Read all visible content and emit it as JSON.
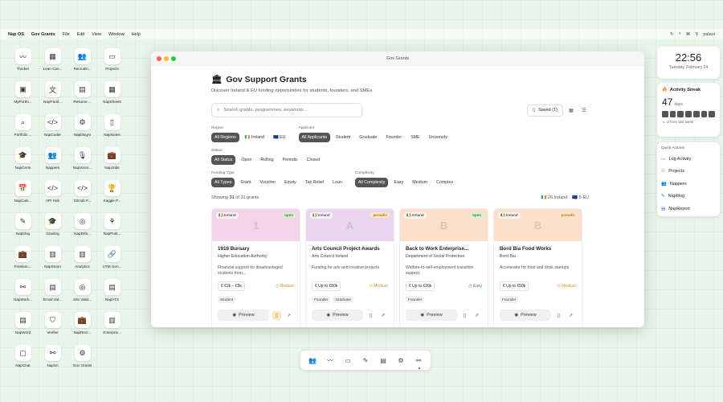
{
  "menubar": {
    "items": [
      "Nap OS",
      "Gov Grants",
      "File",
      "Edit",
      "View",
      "Window",
      "Help"
    ],
    "user": "palani"
  },
  "desktop": [
    {
      "label": "Tracker",
      "icon": "〰"
    },
    {
      "label": "Lean Can...",
      "icon": "▦"
    },
    {
      "label": "Recruitin...",
      "icon": "👥"
    },
    {
      "label": "Projects",
      "icon": "▭"
    },
    {
      "label": "MyPortfo...",
      "icon": "▣"
    },
    {
      "label": "NapParal...",
      "icon": "文"
    },
    {
      "label": "Resume ...",
      "icon": "▤"
    },
    {
      "label": "NapSheets",
      "icon": "▦"
    },
    {
      "label": "Portfolio ...",
      "icon": "⌕"
    },
    {
      "label": "NapCoder",
      "icon": "</>"
    },
    {
      "label": "NapblogAI",
      "icon": "⚙"
    },
    {
      "label": "NapNotes",
      "icon": "▯"
    },
    {
      "label": "NapCerts",
      "icon": "🎓"
    },
    {
      "label": "Nappers",
      "icon": "👥"
    },
    {
      "label": "NapVoice...",
      "icon": "🎙"
    },
    {
      "label": "NapJobs",
      "icon": "💼"
    },
    {
      "label": "NapCale...",
      "icon": "📅"
    },
    {
      "label": "API Hub",
      "icon": "</>"
    },
    {
      "label": "GitHub P...",
      "icon": "</>"
    },
    {
      "label": "Kaggle P...",
      "icon": "🏆"
    },
    {
      "label": "Napblog",
      "icon": "✎"
    },
    {
      "label": "Grading",
      "icon": "🎓"
    },
    {
      "label": "NapDrib...",
      "icon": "◎"
    },
    {
      "label": "NapPost...",
      "icon": "⚘"
    },
    {
      "label": "Freelanc...",
      "icon": "💼"
    },
    {
      "label": "NapStrom",
      "icon": "▥"
    },
    {
      "label": "Analytics",
      "icon": "▥"
    },
    {
      "label": "UTM Gen...",
      "icon": "🔗"
    },
    {
      "label": "NapWork...",
      "icon": "⚯"
    },
    {
      "label": "Email Val...",
      "icon": "▤"
    },
    {
      "label": "Site Valid...",
      "icon": "◎"
    },
    {
      "label": "NapATS",
      "icon": "▤"
    },
    {
      "label": "NapWord",
      "icon": "▤"
    },
    {
      "label": "Verifier",
      "icon": "⛉"
    },
    {
      "label": "NapRecr...",
      "icon": "💼"
    },
    {
      "label": "Enterpris...",
      "icon": "▥"
    },
    {
      "label": "NapChat",
      "icon": "▢"
    },
    {
      "label": "NapSn",
      "icon": "⚯"
    },
    {
      "label": "Gov Grants",
      "icon": "⚙"
    }
  ],
  "window": {
    "title": "Gov Grants",
    "heading": "Gov Support Grants",
    "subtitle": "Discover Ireland & EU funding opportunities for students, founders, and SMEs",
    "search_placeholder": "Search grants, programmes, keywords...",
    "saved_label": "Saved (1)",
    "filters": {
      "region": {
        "label": "Region",
        "options": [
          "All Regions",
          "🇮🇪 Ireland",
          "🇪🇺 EU"
        ]
      },
      "applicant": {
        "label": "Applicant",
        "options": [
          "All Applicants",
          "Student",
          "Graduate",
          "Founder",
          "SME",
          "University"
        ]
      },
      "status": {
        "label": "Status",
        "options": [
          "All Status",
          "Open",
          "Rolling",
          "Periodic",
          "Closed"
        ]
      },
      "funding": {
        "label": "Funding Type",
        "options": [
          "All Types",
          "Grant",
          "Voucher",
          "Equity",
          "Tax Relief",
          "Loan"
        ]
      },
      "complexity": {
        "label": "Complexity",
        "options": [
          "All Complexity",
          "Easy",
          "Medium",
          "Complex"
        ]
      }
    },
    "count": {
      "prefix": "Showing",
      "shown": "31",
      "suffix": "of 31 grants",
      "ireland": "🇮🇪 26 Ireland",
      "eu": "🇪🇺 5 EU"
    },
    "cards": [
      {
        "flag": "🇮🇪 Ireland",
        "status": "open",
        "letter": "1",
        "title": "1916 Bursary",
        "org": "Higher Education Authority",
        "desc": "Financial support for disadvantaged students from...",
        "amount": "€2k – €5k",
        "complexity": "Medium",
        "tags": [
          "Student"
        ],
        "preview": "Preview",
        "banner": "#f3d4ea",
        "stat_bg": "#d7f0d6",
        "stat_fg": "#3a8a3a",
        "cx_color": "#c99a1e"
      },
      {
        "flag": "🇮🇪 Ireland",
        "status": "periodic",
        "letter": "A",
        "title": "Arts Council Project Awards",
        "org": "Arts Council Ireland",
        "desc": "Funding for arts and creative projects",
        "amount": "Up to €80k",
        "complexity": "Medium",
        "tags": [
          "Founder",
          "Graduate"
        ],
        "preview": "Preview",
        "banner": "#ead6f1",
        "stat_bg": "#fbe8c4",
        "stat_fg": "#b57a12",
        "cx_color": "#c99a1e"
      },
      {
        "flag": "🇮🇪 Ireland",
        "status": "open",
        "letter": "B",
        "title": "Back to Work Enterprise...",
        "org": "Department of Social Protection",
        "desc": "Welfare-to-self-employment transition support",
        "amount": "Up to €20k",
        "complexity": "Easy",
        "tags": [
          "Founder"
        ],
        "preview": "Preview",
        "banner": "#fde0cc",
        "stat_bg": "#d7f0d6",
        "stat_fg": "#3a8a3a",
        "cx_color": "#3a8a3a"
      },
      {
        "flag": "🇮🇪 Ireland",
        "status": "periodic",
        "letter": "B",
        "title": "Bord Bia Food Works",
        "org": "Bord Bia",
        "desc": "Accelerator for food and drink startups",
        "amount": "Up to €50k",
        "complexity": "Medium",
        "tags": [
          "Founder"
        ],
        "preview": "Preview",
        "banner": "#fde0cc",
        "stat_bg": "#fbe8c4",
        "stat_fg": "#b57a12",
        "cx_color": "#c99a1e"
      }
    ]
  },
  "clock": {
    "time": "22:56",
    "date": "Tuesday, February 24"
  },
  "streak": {
    "title": "Activity Streak",
    "days": "47",
    "unit": "days",
    "change": "↘ -2 from last week"
  },
  "quick_actions": {
    "title": "Quick Actions",
    "items": [
      "Log Activity",
      "Projects",
      "Nappers",
      "Napblog",
      "NapReport"
    ]
  },
  "dock": [
    "👥",
    "〰",
    "▭",
    "✎",
    "▤",
    "⚙",
    "⚯"
  ]
}
